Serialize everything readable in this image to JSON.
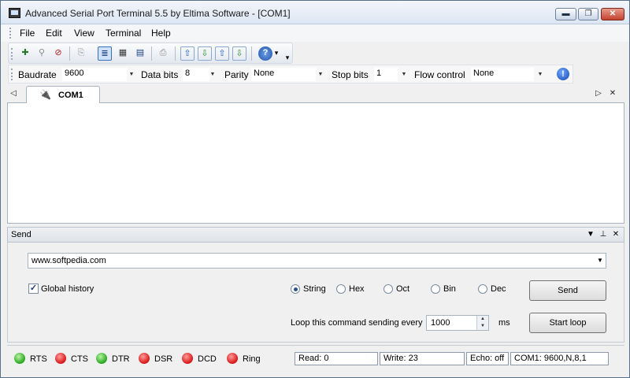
{
  "window": {
    "title": "Advanced Serial Port Terminal 5.5 by Eltima Software - [COM1]",
    "min_glyph": "▬",
    "max_glyph": "❐",
    "close_glyph": "✕"
  },
  "menu": [
    "File",
    "Edit",
    "View",
    "Terminal",
    "Help"
  ],
  "toolbar": {
    "buttons": [
      {
        "icon": "new-connection-icon",
        "glyph": "✚"
      },
      {
        "icon": "search-icon",
        "glyph": "⚲"
      },
      {
        "icon": "disconnect-icon",
        "glyph": "⊘"
      },
      {
        "icon": "copy-icon",
        "glyph": "⎘"
      },
      {
        "icon": "text-view-icon",
        "glyph": "≣"
      },
      {
        "icon": "hex-view-icon",
        "glyph": "▦"
      },
      {
        "icon": "table-view-icon",
        "glyph": "▤"
      },
      {
        "icon": "print-icon",
        "glyph": "⎙"
      },
      {
        "icon": "send-file-icon",
        "glyph": "⇧"
      },
      {
        "icon": "receive-file-icon",
        "glyph": "⇩"
      },
      {
        "icon": "send-binary-icon",
        "glyph": "⇧"
      },
      {
        "icon": "receive-binary-icon",
        "glyph": "⇩"
      },
      {
        "icon": "help-icon",
        "glyph": "?"
      }
    ],
    "dropdown_glyph": "▾"
  },
  "port_settings": {
    "baudrate_label": "Baudrate",
    "baudrate_value": "9600",
    "databits_label": "Data bits",
    "databits_value": "8",
    "parity_label": "Parity",
    "parity_value": "None",
    "stopbits_label": "Stop bits",
    "stopbits_value": "1",
    "flow_label": "Flow control",
    "flow_value": "None",
    "info_glyph": "!",
    "arrow_glyph": "▼"
  },
  "tabs": {
    "left_glyph": "◁",
    "right_glyph": "▷",
    "close_glyph": "✕",
    "active_label": "COM1",
    "icon_glyph": "🔌"
  },
  "send_panel": {
    "title": "Send",
    "command": "www.softpedia.com",
    "global_history_label": "Global history",
    "global_history_checked": true,
    "check_glyph": "✓",
    "formats": [
      {
        "label": "String",
        "selected": true
      },
      {
        "label": "Hex",
        "selected": false
      },
      {
        "label": "Oct",
        "selected": false
      },
      {
        "label": "Bin",
        "selected": false
      },
      {
        "label": "Dec",
        "selected": false
      }
    ],
    "send_button": "Send",
    "loop_label": "Loop this command sending every",
    "loop_value": "1000",
    "loop_unit": "ms",
    "start_loop_button": "Start loop",
    "hdr_dropdown_glyph": "▼",
    "hdr_pin_glyph": "⊥",
    "hdr_close_glyph": "✕",
    "spin_up": "▲",
    "spin_down": "▼"
  },
  "status": {
    "leds": [
      {
        "label": "RTS",
        "state": "green"
      },
      {
        "label": "CTS",
        "state": "red"
      },
      {
        "label": "DTR",
        "state": "green"
      },
      {
        "label": "DSR",
        "state": "red"
      },
      {
        "label": "DCD",
        "state": "red"
      },
      {
        "label": "Ring",
        "state": "red"
      }
    ],
    "read": "Read:  0",
    "write": "Write:  23",
    "echo": "Echo: off",
    "port_info": "COM1: 9600,N,8,1"
  }
}
